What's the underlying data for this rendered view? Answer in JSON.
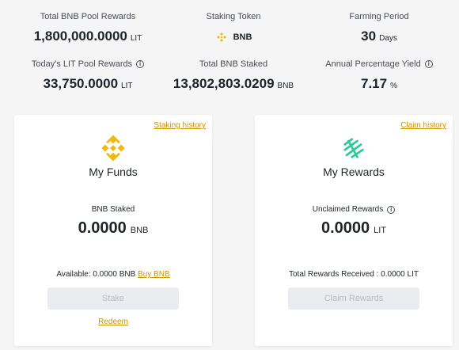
{
  "stats": {
    "pool_rewards": {
      "label": "Total BNB Pool Rewards",
      "value": "1,800,000.0000",
      "unit": "LIT"
    },
    "staking_token": {
      "label": "Staking Token",
      "value": "BNB"
    },
    "farming_period": {
      "label": "Farming Period",
      "value": "30",
      "unit": "Days"
    },
    "today_rewards": {
      "label": "Today's LIT Pool Rewards",
      "value": "33,750.0000",
      "unit": "LIT"
    },
    "total_staked": {
      "label": "Total BNB Staked",
      "value": "13,802,803.0209",
      "unit": "BNB"
    },
    "apy": {
      "label": "Annual Percentage Yield",
      "value": "7.17",
      "unit": "%"
    }
  },
  "funds": {
    "link": "Staking history",
    "title": "My Funds",
    "sub_label": "BNB Staked",
    "amount": "0.0000",
    "unit": "BNB",
    "available": "Available: 0.0000 BNB",
    "buy_link": "Buy BNB",
    "button": "Stake",
    "redeem": "Redeem"
  },
  "rewards": {
    "link": "Claim history",
    "title": "My Rewards",
    "sub_label": "Unclaimed Rewards",
    "amount": "0.0000",
    "unit": "LIT",
    "received": "Total Rewards Received : 0.0000 LIT",
    "button": "Claim Rewards"
  },
  "colors": {
    "accent": "#c99400",
    "bnb": "#f0b90b",
    "lit": "#2bcb9a"
  },
  "icons": {
    "bnb": "bnb-logo-icon",
    "lit": "litentry-logo-icon",
    "info": "info-icon"
  }
}
